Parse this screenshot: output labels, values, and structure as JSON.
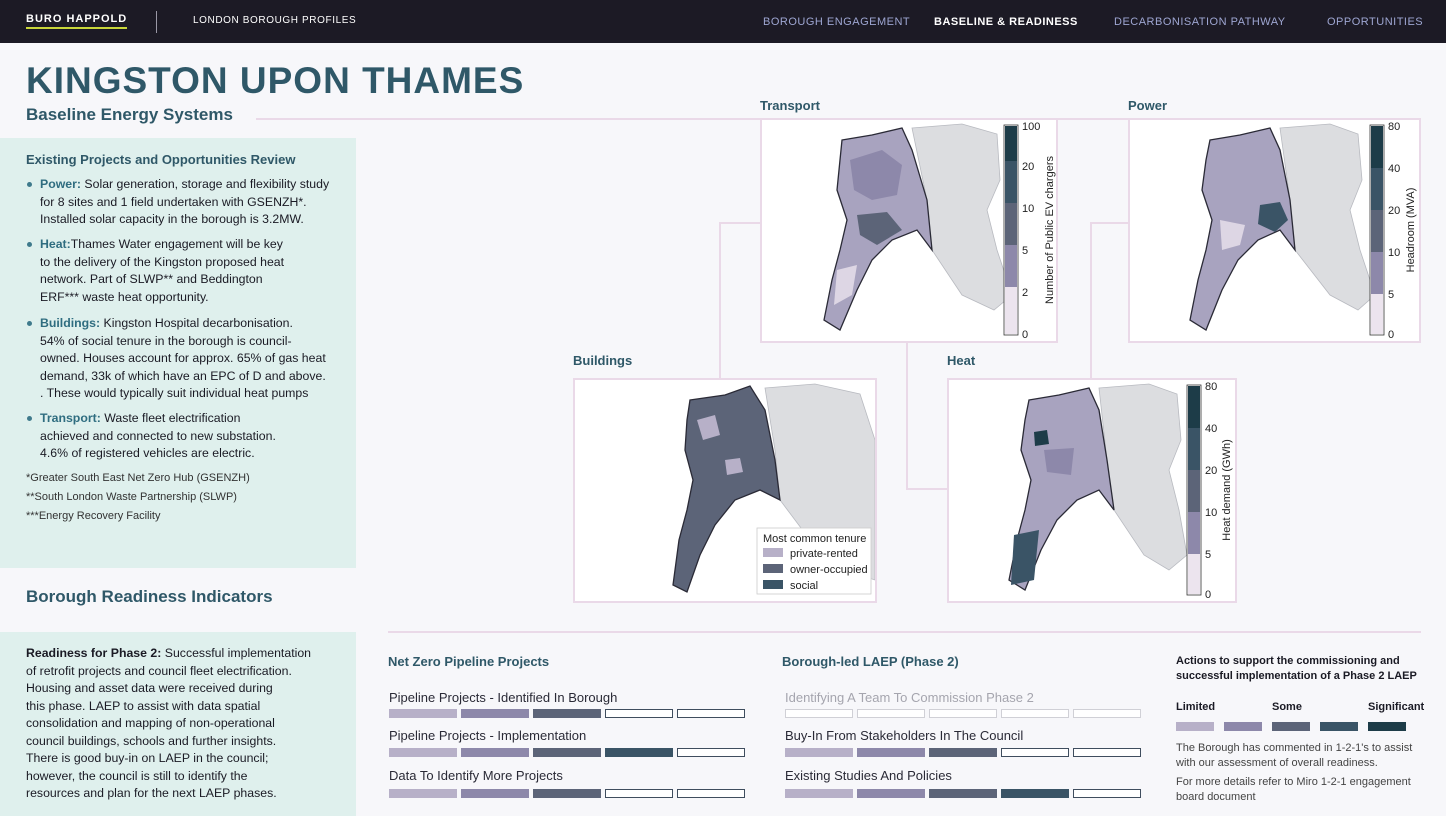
{
  "header": {
    "brand": "BURO HAPPOLD",
    "subtitle": "LONDON BOROUGH PROFILES",
    "nav": [
      "BOROUGH ENGAGEMENT",
      "BASELINE & READINESS",
      "DECARBONISATION PATHWAY",
      "OPPORTUNITIES"
    ],
    "active_nav": "BASELINE & READINESS"
  },
  "page": {
    "title": "KINGSTON UPON THAMES",
    "section": "Baseline Energy Systems"
  },
  "projects": {
    "heading": "Existing Projects and Opportunities Review",
    "items": [
      {
        "label": "Power:",
        "lines": [
          "Solar generation, storage and flexibility study",
          "for 8 sites and 1 field undertaken with GSENZH*.",
          "Installed solar capacity in the borough is 3.2MW."
        ]
      },
      {
        "label": "Heat:",
        "lines": [
          "Thames Water engagement will be key",
          "to the delivery of the Kingston proposed heat",
          "network. Part of SLWP** and Beddington",
          "ERF*** waste heat opportunity."
        ]
      },
      {
        "label": "Buildings:",
        "lines": [
          "Kingston Hospital decarbonisation.",
          "54% of social tenure in the borough is council-",
          "owned. Houses account for approx. 65% of gas heat",
          "demand, 33k of which have an EPC of D and above.",
          ". These would typically suit individual heat pumps"
        ]
      },
      {
        "label": "Transport:",
        "lines": [
          "Waste fleet electrification",
          "achieved and connected to new substation.",
          "4.6% of registered vehicles are electric."
        ]
      }
    ],
    "footnotes": [
      "*Greater South East Net Zero Hub (GSENZH)",
      "**South London Waste Partnership (SLWP)",
      "***Energy Recovery Facility"
    ]
  },
  "readiness": {
    "heading": "Borough Readiness Indicators",
    "label": "Readiness for Phase 2:",
    "lines": [
      "Successful implementation",
      "of retrofit projects and council fleet electrification.",
      "Housing and asset data were received during",
      "this phase. LAEP to assist with data spatial",
      "consolidation and mapping of non-operational",
      "council buildings, schools and further insights.",
      "There is good buy-in on LAEP in the council;",
      "however, the council is still to identify the",
      "resources and plan for the next LAEP phases."
    ]
  },
  "maps": {
    "transport": {
      "label": "Transport",
      "colorbar_label": "Number of Public EV chargers",
      "ticks": [
        "100",
        "20",
        "10",
        "5",
        "2",
        "0"
      ]
    },
    "power": {
      "label": "Power",
      "colorbar_label": "Headroom (MVA)",
      "ticks": [
        "80",
        "40",
        "20",
        "10",
        "5",
        "0"
      ]
    },
    "buildings": {
      "label": "Buildings",
      "legend_title": "Most common tenure",
      "legend": [
        {
          "name": "private-rented",
          "color": "#b7b0c8"
        },
        {
          "name": "owner-occupied",
          "color": "#5c6478"
        },
        {
          "name": "social",
          "color": "#3a5466"
        }
      ]
    },
    "heat": {
      "label": "Heat",
      "colorbar_label": "Heat demand (GWh)",
      "ticks": [
        "80",
        "40",
        "20",
        "10",
        "5",
        "0"
      ]
    }
  },
  "pipeline": {
    "heading": "Net Zero Pipeline Projects",
    "rows": [
      {
        "label": "Pipeline Projects - Identified In Borough",
        "level": 3
      },
      {
        "label": "Pipeline Projects - Implementation",
        "level": 4
      },
      {
        "label": "Data To Identify More Projects",
        "level": 3
      }
    ]
  },
  "laep": {
    "heading": "Borough-led LAEP (Phase 2)",
    "rows": [
      {
        "label": "Identifying A Team To Commission Phase 2",
        "level": 0
      },
      {
        "label": "Buy-In From Stakeholders In The Council",
        "level": 3
      },
      {
        "label": "Existing Studies And Policies",
        "level": 4
      }
    ]
  },
  "actions": {
    "heading": "Actions to support the commissioning and successful implementation of a Phase 2 LAEP",
    "levels": [
      "Limited",
      "Some",
      "Significant"
    ],
    "colors": [
      "#b7b0c8",
      "#8d88aa",
      "#5c6478",
      "#3a5466",
      "#1d3c48"
    ],
    "note1": "The Borough has commented in 1-2-1's to assist with our assessment of overall readiness.",
    "note2": "For more details refer to Miro 1-2-1 engagement board document"
  }
}
